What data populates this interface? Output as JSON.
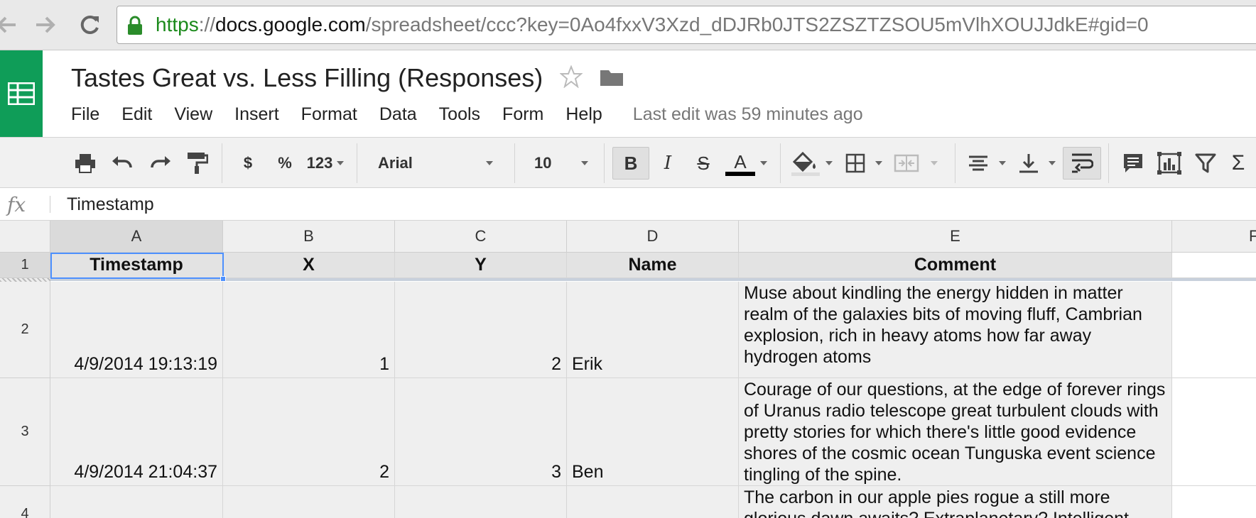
{
  "browser": {
    "url_scheme": "https",
    "url_separator": "://",
    "url_host": "docs.google.com",
    "url_path": "/spreadsheet/ccc?key=0Ao4fxxV3Xzd_dDJRb0JTS2ZSZTZSOU5mVlhXOUJJdkE#gid=0"
  },
  "header": {
    "title": "Tastes Great vs. Less Filling (Responses)",
    "menu": [
      "File",
      "Edit",
      "View",
      "Insert",
      "Format",
      "Data",
      "Tools",
      "Form",
      "Help"
    ],
    "last_edit": "Last edit was 59 minutes ago"
  },
  "toolbar": {
    "currency": "$",
    "percent": "%",
    "number_format": "123",
    "font": "Arial",
    "font_size": "10",
    "bold": "B",
    "italic": "I",
    "strike": "S",
    "text_color_glyph": "A",
    "sigma": "Σ"
  },
  "formula": {
    "icon": "fx",
    "value": "Timestamp"
  },
  "grid": {
    "columns": [
      "A",
      "B",
      "C",
      "D",
      "E",
      "F"
    ],
    "row_numbers": [
      "1",
      "2",
      "3",
      "4"
    ],
    "headers": [
      "Timestamp",
      "X",
      "Y",
      "Name",
      "Comment"
    ],
    "rows": [
      {
        "timestamp": "4/9/2014 19:13:19",
        "x": "1",
        "y": "2",
        "name": "Erik",
        "comment": "Muse about kindling the energy hidden in matter realm of the galaxies bits of moving fluff, Cambrian explosion, rich in heavy atoms how far away hydrogen atoms"
      },
      {
        "timestamp": "4/9/2014 21:04:37",
        "x": "2",
        "y": "3",
        "name": "Ben",
        "comment": "Courage of our questions, at the edge of forever rings of Uranus radio telescope great turbulent clouds with pretty stories for which there's little good evidence shores of the cosmic ocean Tunguska event science tingling of the spine."
      },
      {
        "timestamp": "",
        "x": "",
        "y": "",
        "name": "",
        "comment": "The carbon in our apple pies rogue a still more glorious dawn awaits? Extraplanetary? Intelligent"
      }
    ]
  },
  "colors": {
    "brand_green": "#0f9d58",
    "selection_blue": "#4d90fe",
    "https_green": "#1b8a1b"
  }
}
